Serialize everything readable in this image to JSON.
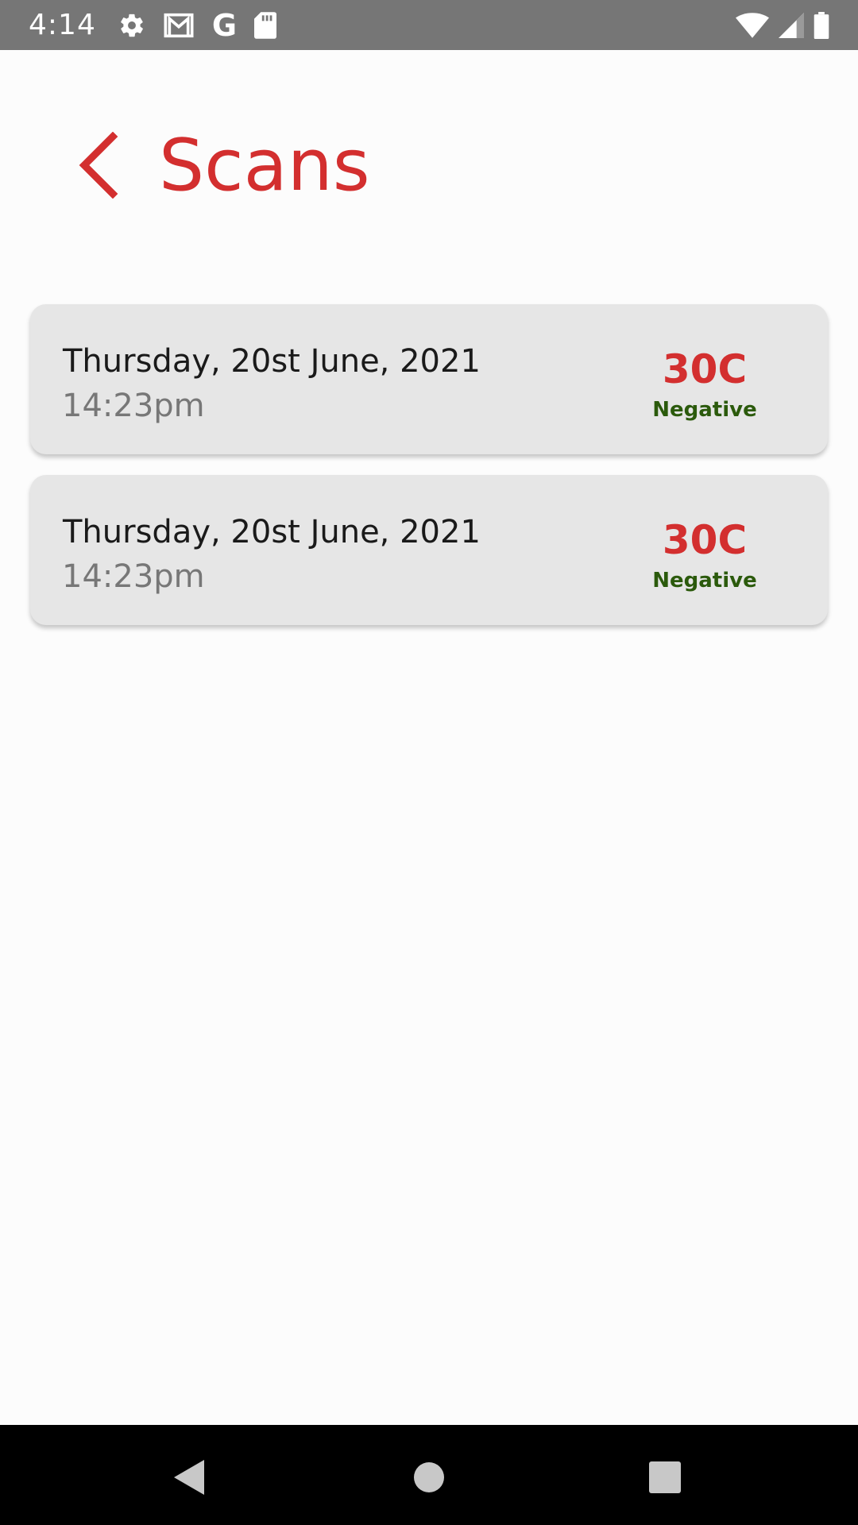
{
  "status_bar": {
    "time": "4:14",
    "icons_left": [
      "settings-icon",
      "gmail-icon",
      "google-icon",
      "sd-card-icon"
    ],
    "icons_right": [
      "wifi-icon",
      "signal-icon",
      "battery-icon"
    ]
  },
  "header": {
    "title": "Scans",
    "back_icon": "chevron-left-icon"
  },
  "colors": {
    "accent": "#d32f2f",
    "result_negative": "#2b5a0c",
    "card_bg": "#e6e6e6"
  },
  "scans": [
    {
      "date": "Thursday, 20st June, 2021",
      "time": "14:23pm",
      "temperature": "30C",
      "result": "Negative"
    },
    {
      "date": "Thursday, 20st June, 2021",
      "time": "14:23pm",
      "temperature": "30C",
      "result": "Negative"
    }
  ],
  "nav_bar": {
    "icons": [
      "nav-back-icon",
      "nav-home-icon",
      "nav-recents-icon"
    ]
  }
}
